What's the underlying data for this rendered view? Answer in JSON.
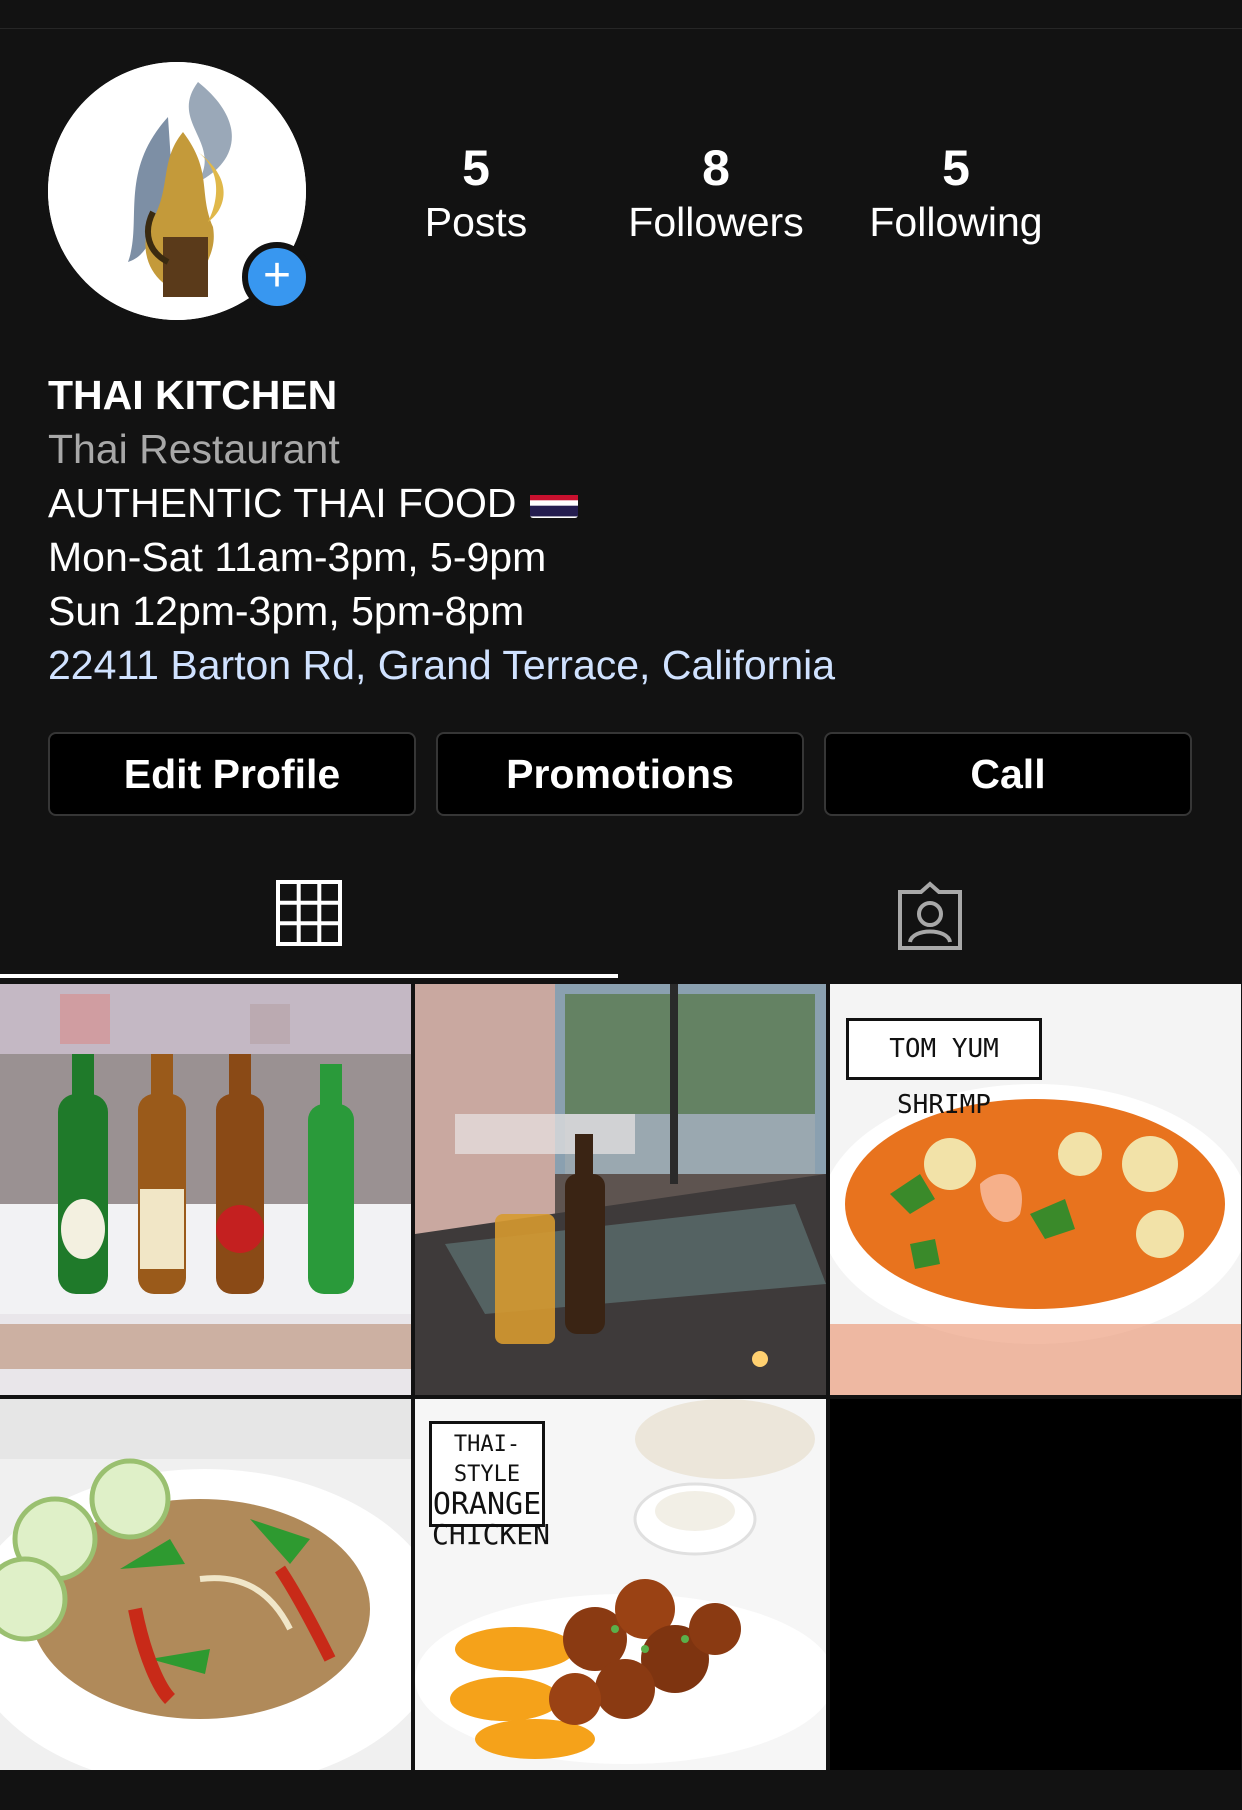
{
  "profile": {
    "stats": [
      {
        "value": "5",
        "label": "Posts"
      },
      {
        "value": "8",
        "label": "Followers"
      },
      {
        "value": "5",
        "label": "Following"
      }
    ],
    "name": "THAI KITCHEN",
    "category": "Thai Restaurant",
    "bio_lines": [
      "AUTHENTIC THAI FOOD",
      "Mon-Sat 11am-3pm, 5-9pm",
      "Sun 12pm-3pm, 5pm-8pm"
    ],
    "address": "22411 Barton Rd, Grand Terrace, California"
  },
  "buttons": {
    "edit": "Edit Profile",
    "promotions": "Promotions",
    "call": "Call"
  },
  "tabs": [
    {
      "icon": "grid-icon",
      "active": true
    },
    {
      "icon": "tagged-person-icon",
      "active": false
    }
  ],
  "posts": [
    {
      "overlay_text": ""
    },
    {
      "overlay_text": ""
    },
    {
      "overlay_text": "TOM YUM SHRIMP"
    },
    {
      "overlay_text": ""
    },
    {
      "overlay_text_lines": [
        "THAI-STYLE",
        "ORANGE",
        "CHICKEN"
      ]
    }
  ],
  "colors": {
    "background": "#121212",
    "accent_blue": "#3897f0",
    "link": "#d0e2ff",
    "secondary_text": "#a8a8a8"
  }
}
